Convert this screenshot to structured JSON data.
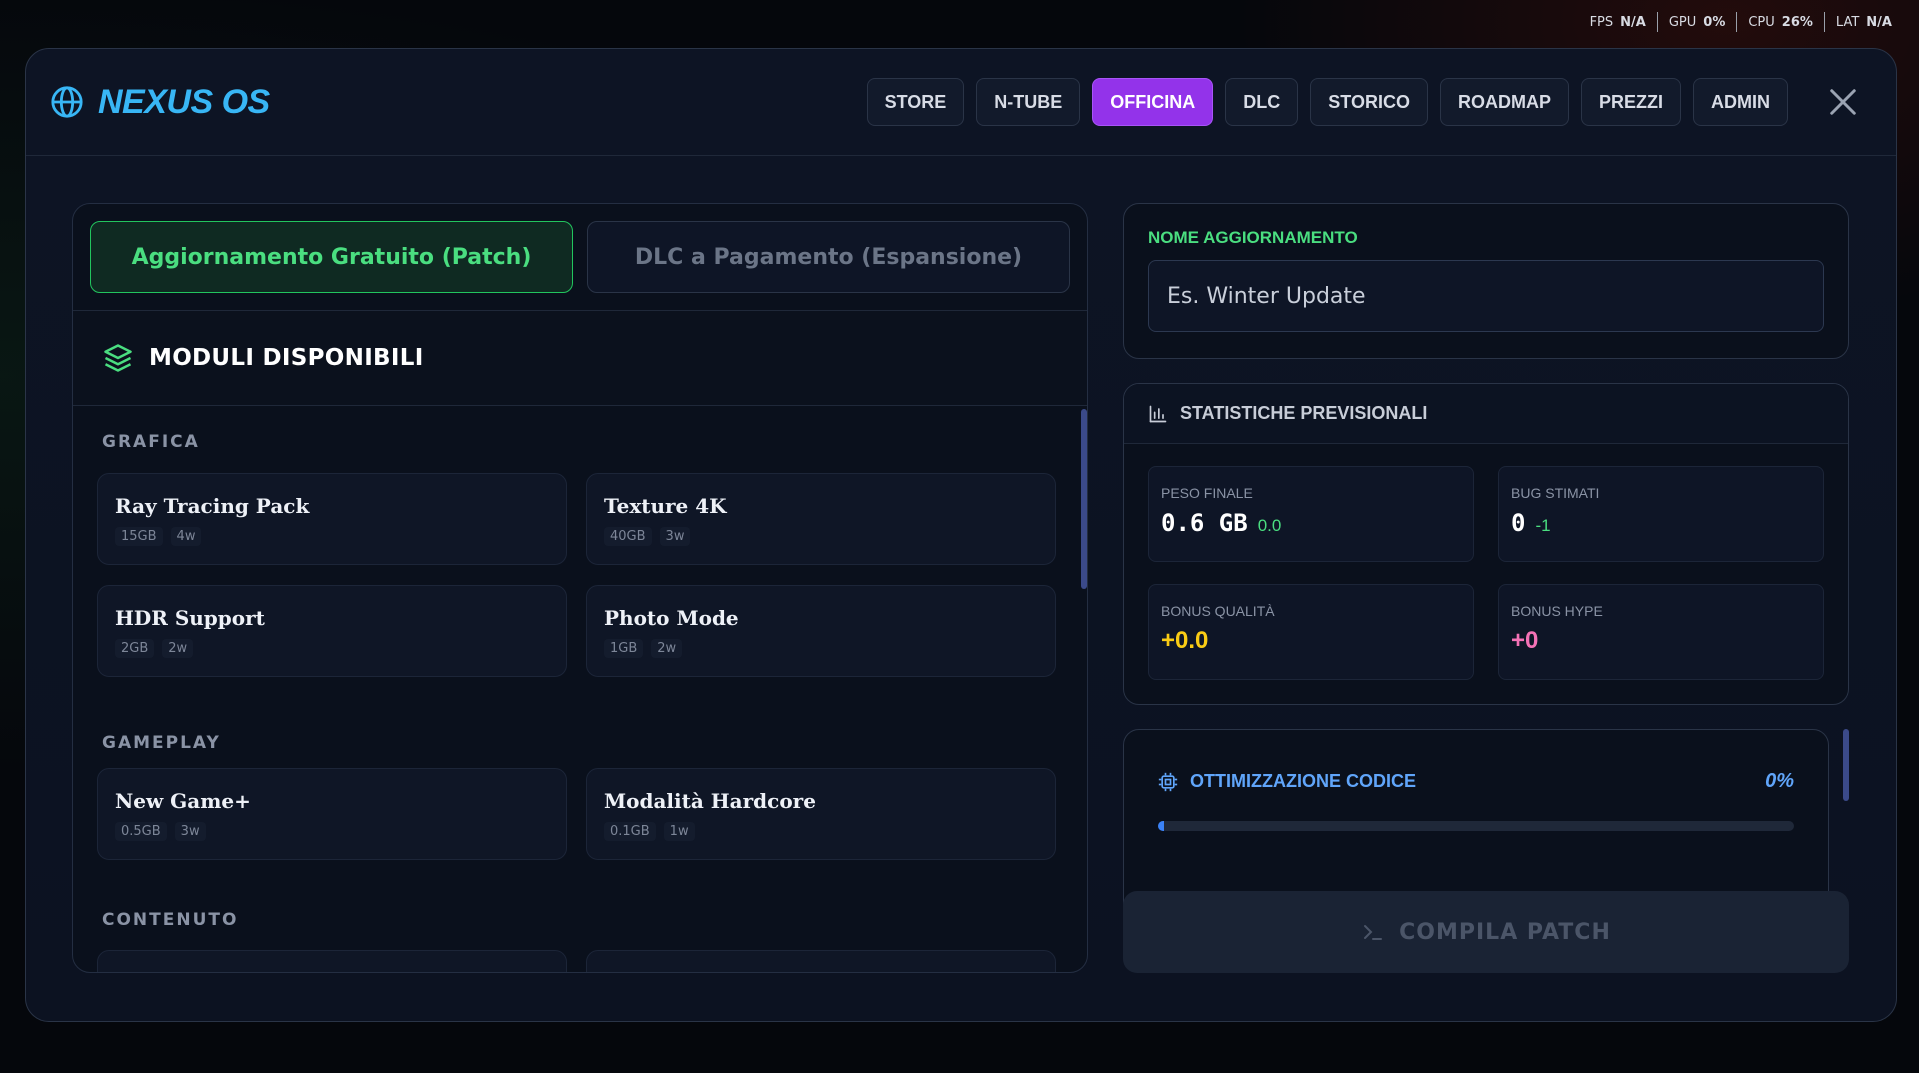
{
  "status_bar": [
    {
      "label": "FPS",
      "value": "N/A"
    },
    {
      "label": "GPU",
      "value": "0%"
    },
    {
      "label": "CPU",
      "value": "26%"
    },
    {
      "label": "LAT",
      "value": "N/A"
    }
  ],
  "app": {
    "title": "NEXUS OS",
    "accent": "#38b6f5"
  },
  "nav": [
    {
      "label": "STORE",
      "active": false
    },
    {
      "label": "N-TUBE",
      "active": false
    },
    {
      "label": "OFFICINA",
      "active": true
    },
    {
      "label": "DLC",
      "active": false
    },
    {
      "label": "STORICO",
      "active": false
    },
    {
      "label": "ROADMAP",
      "active": false
    },
    {
      "label": "PREZZI",
      "active": false
    },
    {
      "label": "ADMIN",
      "active": false
    }
  ],
  "tabs": [
    {
      "label": "Aggiornamento Gratuito (Patch)",
      "active": true
    },
    {
      "label": "DLC a Pagamento (Espansione)",
      "active": false
    }
  ],
  "modules": {
    "title": "MODULI DISPONIBILI",
    "categories": [
      {
        "name": "GRAFICA",
        "items": [
          {
            "name": "Ray Tracing Pack",
            "size": "15GB",
            "time": "4w"
          },
          {
            "name": "Texture 4K",
            "size": "40GB",
            "time": "3w"
          },
          {
            "name": "HDR Support",
            "size": "2GB",
            "time": "2w"
          },
          {
            "name": "Photo Mode",
            "size": "1GB",
            "time": "2w"
          }
        ]
      },
      {
        "name": "GAMEPLAY",
        "items": [
          {
            "name": "New Game+",
            "size": "0.5GB",
            "time": "3w"
          },
          {
            "name": "Modalità Hardcore",
            "size": "0.1GB",
            "time": "1w"
          }
        ]
      },
      {
        "name": "CONTENUTO",
        "items": []
      }
    ]
  },
  "update_name": {
    "label": "NOME AGGIORNAMENTO",
    "placeholder": "Es. Winter Update",
    "value": ""
  },
  "stats": {
    "title": "STATISTICHE PREVISIONALI",
    "peso": {
      "label": "PESO FINALE",
      "value": "0.6 GB",
      "delta": "0.0"
    },
    "bug": {
      "label": "BUG STIMATI",
      "value": "0",
      "delta": "-1"
    },
    "qualita": {
      "label": "BONUS QUALITÀ",
      "value": "+0.0"
    },
    "hype": {
      "label": "BONUS HYPE",
      "value": "+0"
    }
  },
  "optimization": {
    "label": "OTTIMIZZAZIONE CODICE",
    "value_text": "0%",
    "progress": 0.01
  },
  "compile": {
    "label": "COMPILA PATCH"
  }
}
